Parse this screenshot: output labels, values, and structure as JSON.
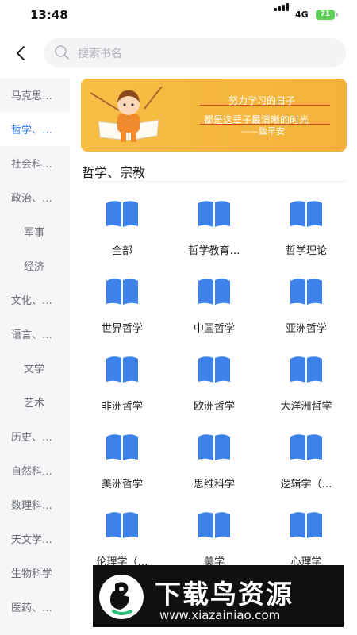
{
  "status_bar": {
    "time": "13:48",
    "network": "4G",
    "battery": "71"
  },
  "search": {
    "placeholder": "搜索书名"
  },
  "sidebar": {
    "items": [
      {
        "label": "马克思…",
        "level": "top",
        "active": false
      },
      {
        "label": "哲学、…",
        "level": "top",
        "active": true
      },
      {
        "label": "社会科…",
        "level": "top",
        "active": false
      },
      {
        "label": "政治、…",
        "level": "top",
        "active": false
      },
      {
        "label": "军事",
        "level": "sub",
        "active": false
      },
      {
        "label": "经济",
        "level": "sub",
        "active": false
      },
      {
        "label": "文化、…",
        "level": "top",
        "active": false
      },
      {
        "label": "语言、…",
        "level": "top",
        "active": false
      },
      {
        "label": "文学",
        "level": "sub",
        "active": false
      },
      {
        "label": "艺术",
        "level": "sub",
        "active": false
      },
      {
        "label": "历史、…",
        "level": "top",
        "active": false
      },
      {
        "label": "自然科…",
        "level": "top",
        "active": false
      },
      {
        "label": "数理科…",
        "level": "top",
        "active": false
      },
      {
        "label": "天文学…",
        "level": "top",
        "active": false
      },
      {
        "label": "生物科学",
        "level": "top",
        "active": false
      },
      {
        "label": "医药、…",
        "level": "top",
        "active": false
      }
    ]
  },
  "banner": {
    "line1": "努力学习的日子",
    "line2": "都是这辈子最清晰的时光",
    "line3": "——致早安"
  },
  "section": {
    "title": "哲学、宗教"
  },
  "categories": [
    "全部",
    "哲学教育…",
    "哲学理论",
    "世界哲学",
    "中国哲学",
    "亚洲哲学",
    "非洲哲学",
    "欧洲哲学",
    "大洋洲哲学",
    "美洲哲学",
    "思维科学",
    "逻辑学（…",
    "伦理学（…",
    "美学",
    "心理学"
  ],
  "colors": {
    "accent": "#2f7cf6",
    "book_icon": "#3c82ea",
    "banner": "#f4b23a"
  },
  "icons": [
    "back-arrow-icon",
    "search-icon",
    "book-icon"
  ],
  "watermark": {
    "text": "下载鸟资源",
    "url": "www.xiazainiao.com"
  }
}
